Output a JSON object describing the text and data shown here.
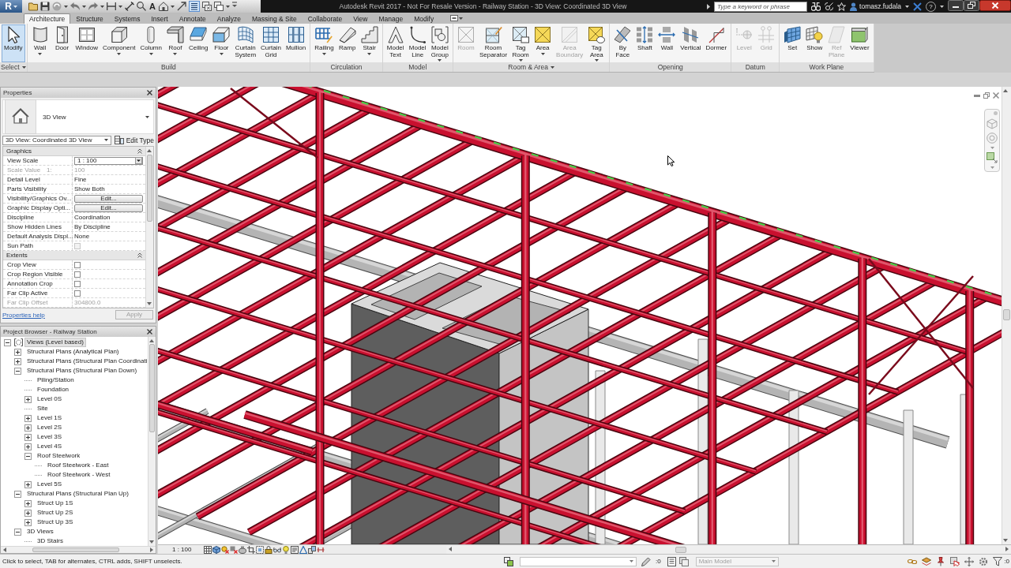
{
  "title_bar": {
    "app_letter": "R",
    "text_tool_glyph": "A",
    "thin_lines": {
      "on": true
    },
    "title": "Autodesk Revit 2017 - Not For Resale Version - Railway Station - 3D View: Coordinated 3D View",
    "search": {
      "placeholder": "Type a keyword or phrase"
    },
    "user": "tomasz.fudala",
    "help_glyph": "?"
  },
  "ribbon": {
    "tabs": [
      {
        "label": "Architecture",
        "selected": true
      },
      {
        "label": "Structure",
        "selected": false
      },
      {
        "label": "Systems",
        "selected": false
      },
      {
        "label": "Insert",
        "selected": false
      },
      {
        "label": "Annotate",
        "selected": false
      },
      {
        "label": "Analyze",
        "selected": false
      },
      {
        "label": "Massing & Site",
        "selected": false
      },
      {
        "label": "Collaborate",
        "selected": false
      },
      {
        "label": "View",
        "selected": false
      },
      {
        "label": "Manage",
        "selected": false
      },
      {
        "label": "Modify",
        "selected": false
      }
    ],
    "panels": [
      {
        "label": "Select",
        "dropdown": true,
        "buttons": [
          {
            "label": "Modify",
            "selected": true,
            "disabled": false,
            "dropdown": false
          }
        ]
      },
      {
        "label": "Build",
        "dropdown": false,
        "buttons": [
          {
            "label": "Wall",
            "selected": false,
            "disabled": false,
            "dropdown": true
          },
          {
            "label": "Door",
            "selected": false,
            "disabled": false,
            "dropdown": false
          },
          {
            "label": "Window",
            "selected": false,
            "disabled": false,
            "dropdown": false
          },
          {
            "label": "Component",
            "selected": false,
            "disabled": false,
            "dropdown": true
          },
          {
            "label": "Column",
            "selected": false,
            "disabled": false,
            "dropdown": true
          },
          {
            "label": "Roof",
            "selected": false,
            "disabled": false,
            "dropdown": true
          },
          {
            "label": "Ceiling",
            "selected": false,
            "disabled": false,
            "dropdown": false
          },
          {
            "label": "Floor",
            "selected": false,
            "disabled": false,
            "dropdown": true
          },
          {
            "label": "Curtain System",
            "selected": false,
            "disabled": false,
            "dropdown": false
          },
          {
            "label": "Curtain Grid",
            "selected": false,
            "disabled": false,
            "dropdown": false
          },
          {
            "label": "Mullion",
            "selected": false,
            "disabled": false,
            "dropdown": false
          }
        ]
      },
      {
        "label": "Circulation",
        "dropdown": false,
        "buttons": [
          {
            "label": "Railing",
            "selected": false,
            "disabled": false,
            "dropdown": true
          },
          {
            "label": "Ramp",
            "selected": false,
            "disabled": false,
            "dropdown": false
          },
          {
            "label": "Stair",
            "selected": false,
            "disabled": false,
            "dropdown": true
          }
        ]
      },
      {
        "label": "Model",
        "dropdown": false,
        "buttons": [
          {
            "label": "Model Text",
            "selected": false,
            "disabled": false,
            "dropdown": false
          },
          {
            "label": "Model Line",
            "selected": false,
            "disabled": false,
            "dropdown": false
          },
          {
            "label": "Model Group",
            "selected": false,
            "disabled": false,
            "dropdown": true
          }
        ]
      },
      {
        "label": "Room & Area",
        "dropdown": true,
        "buttons": [
          {
            "label": "Room",
            "selected": false,
            "disabled": true,
            "dropdown": false
          },
          {
            "label": "Room Separator",
            "selected": false,
            "disabled": false,
            "dropdown": false
          },
          {
            "label": "Tag Room",
            "selected": false,
            "disabled": false,
            "dropdown": true
          },
          {
            "label": "Area",
            "selected": false,
            "disabled": false,
            "dropdown": true
          },
          {
            "label": "Area Boundary",
            "selected": false,
            "disabled": true,
            "dropdown": false
          },
          {
            "label": "Tag Area",
            "selected": false,
            "disabled": false,
            "dropdown": true
          }
        ]
      },
      {
        "label": "Opening",
        "dropdown": false,
        "buttons": [
          {
            "label": "By Face",
            "selected": false,
            "disabled": false,
            "dropdown": false
          },
          {
            "label": "Shaft",
            "selected": false,
            "disabled": false,
            "dropdown": false
          },
          {
            "label": "Wall",
            "selected": false,
            "disabled": false,
            "dropdown": false
          },
          {
            "label": "Vertical",
            "selected": false,
            "disabled": false,
            "dropdown": false
          },
          {
            "label": "Dormer",
            "selected": false,
            "disabled": false,
            "dropdown": false
          }
        ]
      },
      {
        "label": "Datum",
        "dropdown": false,
        "buttons": [
          {
            "label": "Level",
            "selected": false,
            "disabled": true,
            "dropdown": false
          },
          {
            "label": "Grid",
            "selected": false,
            "disabled": true,
            "dropdown": false
          }
        ]
      },
      {
        "label": "Work Plane",
        "dropdown": false,
        "buttons": [
          {
            "label": "Set",
            "selected": false,
            "disabled": false,
            "dropdown": false
          },
          {
            "label": "Show",
            "selected": false,
            "disabled": false,
            "dropdown": false
          },
          {
            "label": "Ref Plane",
            "selected": false,
            "disabled": true,
            "dropdown": false
          },
          {
            "label": "Viewer",
            "selected": false,
            "disabled": false,
            "dropdown": false
          }
        ]
      }
    ]
  },
  "properties": {
    "title": "Properties",
    "type_name": "3D View",
    "instance": "3D View: Coordinated 3D View",
    "edit_type": "Edit Type",
    "groups": [
      {
        "label": "Graphics",
        "expanded": true,
        "rows": [
          {
            "name": "View Scale",
            "kind": "dropdown",
            "value": "1 : 100",
            "disabled": false
          },
          {
            "name": "Scale Value",
            "suffix": "1:",
            "kind": "text",
            "value": "100",
            "disabled": true
          },
          {
            "name": "Detail Level",
            "kind": "text",
            "value": "Fine",
            "disabled": false
          },
          {
            "name": "Parts Visibility",
            "kind": "text",
            "value": "Show Both",
            "disabled": false
          },
          {
            "name": "Visibility/Graphics Ov...",
            "kind": "button",
            "value": "Edit...",
            "disabled": false
          },
          {
            "name": "Graphic Display Opti...",
            "kind": "button",
            "value": "Edit...",
            "disabled": false
          },
          {
            "name": "Discipline",
            "kind": "text",
            "value": "Coordination",
            "disabled": false
          },
          {
            "name": "Show Hidden Lines",
            "kind": "text",
            "value": "By Discipline",
            "disabled": false
          },
          {
            "name": "Default Analysis Displ...",
            "kind": "text",
            "value": "None",
            "disabled": false
          },
          {
            "name": "Sun Path",
            "kind": "checkbox",
            "checked": false,
            "disabled": true
          }
        ]
      },
      {
        "label": "Extents",
        "expanded": true,
        "rows": [
          {
            "name": "Crop View",
            "kind": "checkbox",
            "checked": false,
            "disabled": false
          },
          {
            "name": "Crop Region Visible",
            "kind": "checkbox",
            "checked": false,
            "disabled": false
          },
          {
            "name": "Annotation Crop",
            "kind": "checkbox",
            "checked": false,
            "disabled": false
          },
          {
            "name": "Far Clip Active",
            "kind": "checkbox",
            "checked": false,
            "disabled": false
          },
          {
            "name": "Far Clip Offset",
            "kind": "text",
            "value": "304800.0",
            "disabled": true
          }
        ]
      }
    ],
    "help_link": "Properties help",
    "apply": {
      "label": "Apply",
      "disabled": true
    }
  },
  "project_browser": {
    "title": "Project Browser - Railway Station",
    "tree": [
      {
        "label": "Views (Level based)",
        "kind": "root",
        "expanded": true,
        "selected": true,
        "children": [
          {
            "label": "Structural Plans (Analytical Plan)",
            "kind": "folder",
            "expanded": false,
            "selected": false
          },
          {
            "label": "Structural Plans (Structural Plan Coordinati",
            "kind": "folder",
            "expanded": false,
            "selected": false
          },
          {
            "label": "Structural Plans (Structural Plan Down)",
            "kind": "folder",
            "expanded": true,
            "selected": false,
            "children": [
              {
                "label": "Piling/Station",
                "kind": "view",
                "selected": false
              },
              {
                "label": "Foundation",
                "kind": "view",
                "selected": false
              },
              {
                "label": "Level 0S",
                "kind": "folder",
                "expanded": false,
                "selected": false
              },
              {
                "label": "Site",
                "kind": "view",
                "selected": false
              },
              {
                "label": "Level 1S",
                "kind": "folder",
                "expanded": false,
                "selected": false
              },
              {
                "label": "Level 2S",
                "kind": "folder",
                "expanded": false,
                "selected": false
              },
              {
                "label": "Level 3S",
                "kind": "folder",
                "expanded": false,
                "selected": false
              },
              {
                "label": "Level 4S",
                "kind": "folder",
                "expanded": false,
                "selected": false
              },
              {
                "label": "Roof Steelwork",
                "kind": "folder",
                "expanded": true,
                "selected": false,
                "children": [
                  {
                    "label": "Roof Steelwork - East",
                    "kind": "view",
                    "selected": false
                  },
                  {
                    "label": "Roof Steelwork - West",
                    "kind": "view",
                    "selected": false
                  }
                ]
              },
              {
                "label": "Level 5S",
                "kind": "folder",
                "expanded": false,
                "selected": false
              }
            ]
          },
          {
            "label": "Structural Plans (Structural Plan Up)",
            "kind": "folder",
            "expanded": true,
            "selected": false,
            "children": [
              {
                "label": "Struct Up 1S",
                "kind": "folder",
                "expanded": false,
                "selected": false
              },
              {
                "label": "Struct Up 2S",
                "kind": "folder",
                "expanded": false,
                "selected": false
              },
              {
                "label": "Struct Up 3S",
                "kind": "folder",
                "expanded": false,
                "selected": false
              }
            ]
          },
          {
            "label": "3D Views",
            "kind": "folder",
            "expanded": true,
            "selected": false,
            "children": [
              {
                "label": "3D Stairs",
                "kind": "view",
                "selected": false
              }
            ]
          }
        ]
      }
    ]
  },
  "view_control_bar": {
    "scale": "1 : 100"
  },
  "status_bar": {
    "message": "Click to select, TAB for alternates, CTRL adds, SHIFT unselects.",
    "editable_count": ":0",
    "design_option": {
      "value": "Main Model",
      "disabled": true
    },
    "filter_count": ":0"
  }
}
